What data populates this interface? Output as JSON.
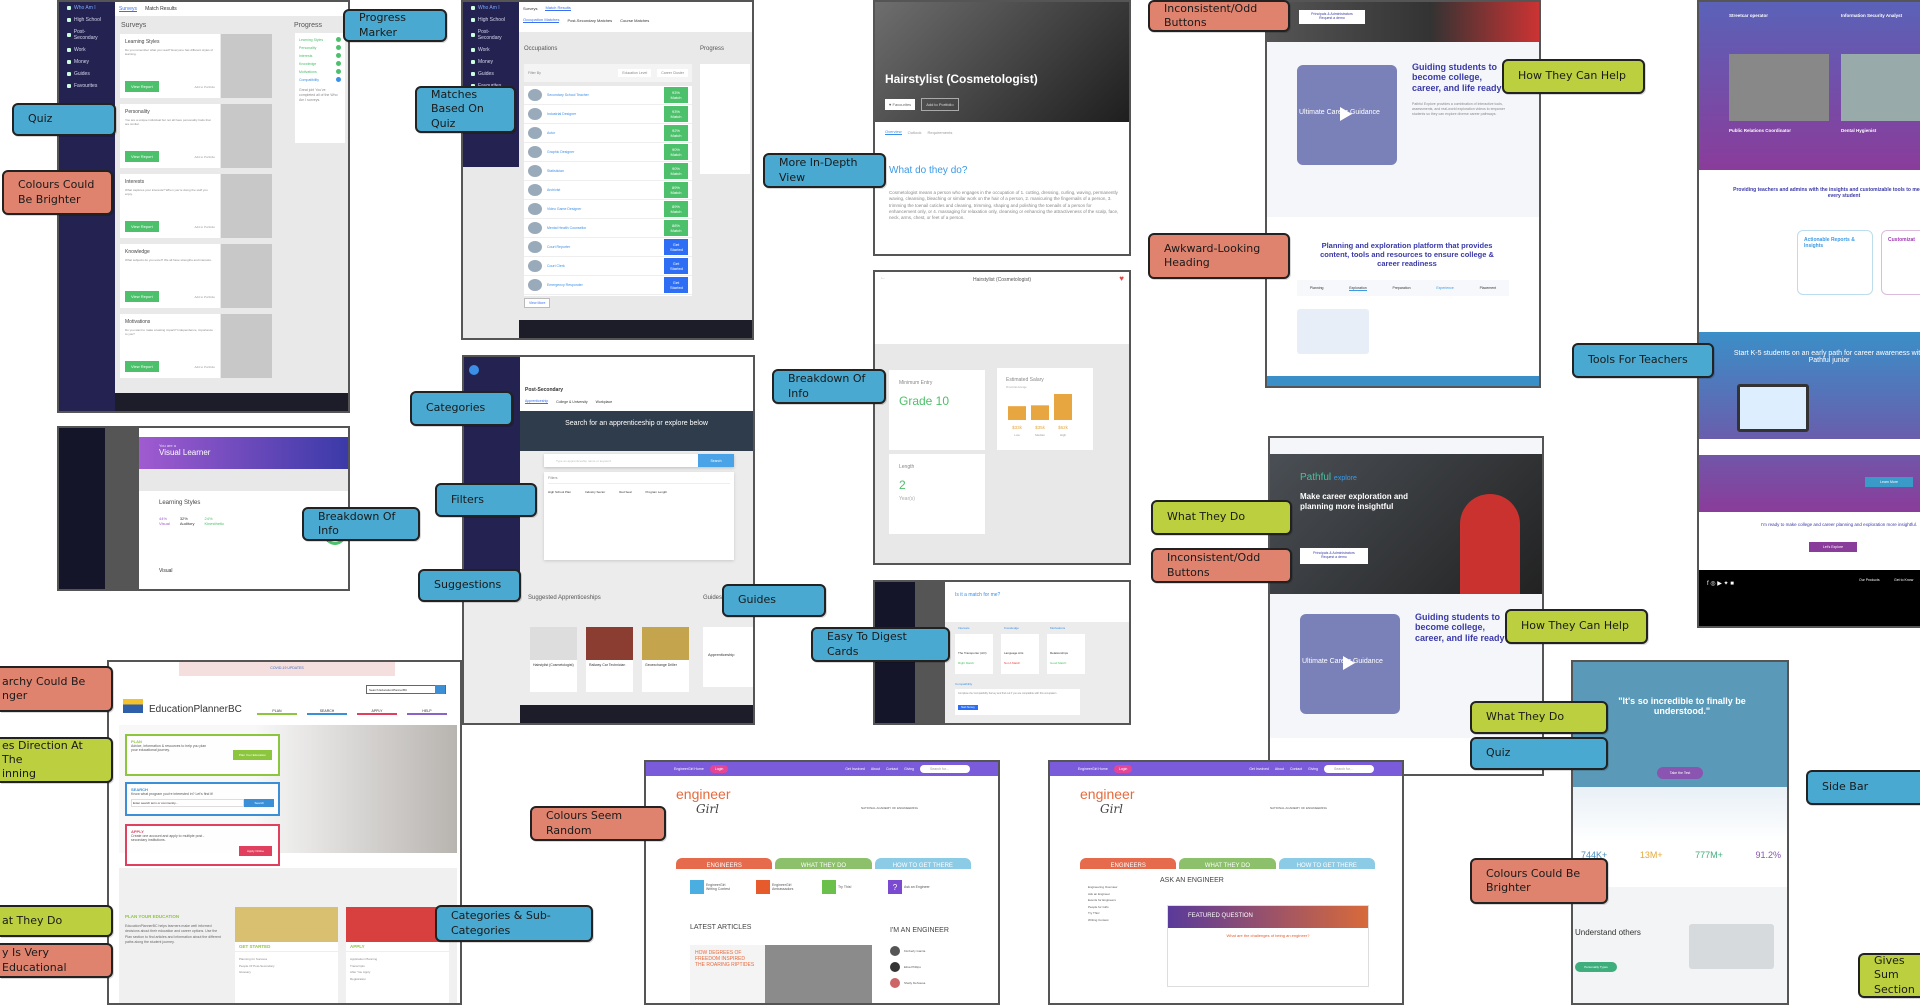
{
  "annotations": {
    "progress_marker": "Progress Marker",
    "quiz_1": "Quiz",
    "colours_brighter_1": "Colours Could Be Brighter",
    "matches_based_on_quiz": "Matches Based On Quiz",
    "more_in_depth_view": "More In-Depth View",
    "inconsistent_buttons_1": "Inconsistent/Odd Buttons",
    "how_they_can_help_1": "How They Can Help",
    "awkward_heading": "Awkward-Looking Heading",
    "tools_for_teachers": "Tools For Teachers",
    "categories": "Categories",
    "breakdown_of_info_1": "Breakdown Of Info",
    "breakdown_of_info_2": "Breakdown Of Info",
    "filters": "Filters",
    "suggestions": "Suggestions",
    "guides": "Guides",
    "easy_to_digest_cards": "Easy To Digest Cards",
    "what_they_do_1": "What They Do",
    "inconsistent_buttons_2": "Inconsistent/Odd Buttons",
    "how_they_can_help_2": "How They Can Help",
    "hierarchy_stronger": "archy Could Be\nnger",
    "gives_direction": "es Direction At The\ninning",
    "colours_seem_random": "Colours Seem Random",
    "what_they_do_2": "What They Do",
    "quiz_2": "Quiz",
    "colours_brighter_2": "Colours Could Be Brighter",
    "side_bar": "Side Bar",
    "what_they_do_3": "at They Do",
    "very_educational": "y Is Very Educational",
    "categories_subcategories": "Categories & Sub-Categories",
    "gives_summary": "Gives Sum\nSection"
  },
  "surveys_screen": {
    "sidebar": [
      "Who Am I",
      "High School",
      "Post-Secondary",
      "Work",
      "Money",
      "Guides",
      "Favourites"
    ],
    "tabs": [
      "Surveys",
      "Match Results"
    ],
    "heading": "Surveys",
    "progress_heading": "Progress",
    "progress_items": [
      "Learning Styles",
      "Personality",
      "Interests",
      "Knowledge",
      "Motivations",
      "Compatibility"
    ],
    "progress_note": "Great job! You've completed all of the Who Am I surveys.",
    "cards": [
      {
        "title": "Learning Styles",
        "button": "View Report",
        "portfolio": "Add to Portfolio"
      },
      {
        "title": "Personality",
        "button": "View Report",
        "portfolio": "Add to Portfolio"
      },
      {
        "title": "Interests",
        "button": "View Report",
        "portfolio": "Add to Portfolio"
      },
      {
        "title": "Knowledge",
        "button": "View Report",
        "portfolio": "Add to Portfolio"
      },
      {
        "title": "Motivations",
        "button": "View Report",
        "portfolio": "Add to Portfolio"
      }
    ]
  },
  "matches_screen": {
    "tabs": [
      "Surveys",
      "Match Results"
    ],
    "subtabs": [
      "Occupation Matches",
      "Post-Secondary Matches",
      "Course Matches"
    ],
    "heading": "Occupations",
    "filter_label": "Filter By",
    "filter_1": "Education Level",
    "filter_2": "Career Cluster",
    "progress_heading": "Progress",
    "rows": [
      {
        "name": "Secondary School Teacher",
        "action": "93% Match"
      },
      {
        "name": "Industrial Designer",
        "action": "93% Match"
      },
      {
        "name": "Actor",
        "action": "92% Match"
      },
      {
        "name": "Graphic Designer",
        "action": "90% Match"
      },
      {
        "name": "Statistician",
        "action": "90% Match"
      },
      {
        "name": "Archivist",
        "action": "89% Match"
      },
      {
        "name": "Video Game Designer",
        "action": "89% Match"
      },
      {
        "name": "Mental Health Counsellor",
        "action": "88% Match"
      },
      {
        "name": "Court Reporter",
        "action": "Get Started"
      },
      {
        "name": "Court Clerk",
        "action": "Get Started"
      },
      {
        "name": "Emergency Responder",
        "action": "Get Started"
      }
    ],
    "view_more": "View More"
  },
  "visual_learner": {
    "subtitle": "You are a",
    "title": "Visual Learner",
    "section": "Learning Styles",
    "stats": [
      {
        "pct": "44%",
        "label": "Visual"
      },
      {
        "pct": "32%",
        "label": "Auditory"
      },
      {
        "pct": "24%",
        "label": "Kinesthetic"
      }
    ],
    "visual_label": "Visual"
  },
  "post_secondary": {
    "heading": "Post-Secondary",
    "tabs": [
      "Apprenticeship",
      "College & University",
      "Workplace"
    ],
    "hero": "Search for an apprenticeship or explore below",
    "search_placeholder": "Type an apprenticeship name or keyword",
    "search_button": "Search",
    "filters_label": "Filters",
    "filter_cols": [
      "High School Plan",
      "Industry Sector",
      "Red Seal",
      "Program Length"
    ],
    "suggested_heading": "Suggested Apprenticeships",
    "suggested": [
      "Hairstylist (Cosmetologist)",
      "Railway Car Technician",
      "Geoexchange Driller"
    ],
    "guides_heading": "Guides",
    "guide_card": "Apprenticeship"
  },
  "hairstylist": {
    "title": "Hairstylist (Cosmetologist)",
    "fav_button": "Favourites",
    "portfolio_button": "Add to Portfolio",
    "tabs": [
      "Overview",
      "Outlook",
      "Requirements"
    ],
    "question": "What do they do?",
    "description": "Cosmetologist means a person who engages in the occupation of 1. cutting, dressing, curling, waving, permanently waving, cleansing, bleaching or similar work on the hair of a person, 2. manicuring the fingernails of a person, 3. trimming the toenail cuticles and cleaning, trimming, shaping and polishing the toenails of a person for enhancement only, or 4. massaging for relaxation only, cleansing or enhancing the attractiveness of the scalp, face, neck, arms, chest, or feet of a person."
  },
  "hairstylist_detail": {
    "header": "Hairstylist (Cosmetologist)",
    "min_entry_label": "Minimum Entry",
    "min_entry_value": "Grade 10",
    "length_label": "Length",
    "length_value": "2",
    "length_unit": "Year(s)",
    "salary_label": "Estimated Salary",
    "salary_sub": "Provincial Average"
  },
  "chart_data": {
    "type": "bar",
    "title": "Estimated Salary",
    "categories": [
      "Low",
      "Median",
      "High"
    ],
    "values": [
      33,
      35,
      62
    ],
    "labels": [
      "$33k",
      "$35k",
      "$62k"
    ],
    "ylabel": "",
    "ylim": [
      0,
      62
    ]
  },
  "match_cards": {
    "heading": "Is it a match for me?",
    "cards": [
      {
        "cat": "Interests",
        "value": "The Transporter (AO)",
        "status": "Right Match",
        "color": "#4cc06a"
      },
      {
        "cat": "Knowledge",
        "value": "Language Arts",
        "status": "Not A Match",
        "color": "#e54545"
      },
      {
        "cat": "Motivations",
        "value": "Relationships",
        "status": "Good Match",
        "color": "#4cc06a"
      }
    ],
    "compat_label": "Compatibility",
    "compat_text": "Complete the Compatibility Survey and find out if you are compatible with this occupation",
    "compat_button": "Start Survey"
  },
  "pathful": {
    "demo_button_1": "Principals & Administrators",
    "demo_button_2": "Request a demo",
    "guiding_heading": "Guiding students to become college, career, and life ready",
    "video_label": "Ultimate Career Guidance",
    "platform_heading": "Planning and exploration platform that provides content, tools and resources to ensure college & career readiness",
    "tabs": [
      "Planning",
      "Exploration",
      "Preparation",
      "Experience",
      "Placement"
    ],
    "logo": "Pathful",
    "logo_sub": "explore",
    "hero_heading": "Make career exploration and planning more insightful"
  },
  "pathful_right": {
    "videos": [
      "Streetcar operator",
      "Information Security Analyst",
      "Public Relations Coordinator",
      "Dental Hygienist"
    ],
    "teachers_heading": "Providing teachers and admins with the insights and customizable tools to meet the needs of every student",
    "card1": "Actionable Reports & Insights",
    "card2": "Customizat",
    "k5_heading": "Start K-5 students on an early path for career awareness with Pathful junior",
    "learn_more": "Learn More",
    "ready_text": "I'm ready to make college and career planning and exploration more insightful.",
    "lets_explore": "Let's Explore",
    "footer_cols": [
      "Our Products",
      "Get to Know"
    ]
  },
  "edplanner": {
    "covid": "COVID-19 UPDATES",
    "search_placeholder": "Search EducationPlannerBC",
    "radio_1": "Site",
    "radio_2": "Programs",
    "logo": "EducationPlannerBC",
    "nav": [
      {
        "label": "PLAN",
        "color": "#8cc63f"
      },
      {
        "label": "SEARCH",
        "color": "#3a8fd6"
      },
      {
        "label": "APPLY",
        "color": "#e0405e"
      },
      {
        "label": "HELP",
        "color": "#8a63c9"
      }
    ],
    "plan_title": "PLAN",
    "plan_text": "Advice, information & resources to help you plan your educational journey.",
    "plan_button": "Plan Your Education",
    "search_title": "SEARCH",
    "search_text": "Know what program you're interested in? Let's find it!",
    "search_input": "Enter search term or community...",
    "search_button": "Search",
    "apply_title": "APPLY",
    "apply_text": "Create one account and apply to multiple post - secondary institutions.",
    "apply_button": "Apply Online",
    "plan_your_ed": "PLAN YOUR EDUCATION",
    "plan_your_ed_text": "EducationPlannerBC helps learners make well informed decisions about their education and career options. Use the Plan section to find articles and information about the different paths along the student journey.",
    "get_started": "GET STARTED",
    "get_started_links": [
      "Planning for Success",
      "People Of Post-Secondary",
      "Glossary"
    ],
    "apply_heading": "APPLY",
    "apply_links": [
      "Application Planning",
      "Transcripts",
      "After You Apply",
      "Registration"
    ]
  },
  "engineergirl": {
    "topnav_home": "EngineerGirl Home",
    "login": "Login",
    "links": [
      "Get Involved",
      "About",
      "Contact",
      "Giving"
    ],
    "search": "Search for...",
    "logo_1": "engineer",
    "logo_2": "Girl",
    "nae": "NATIONAL ACADEMY OF ENGINEERING",
    "tabs": [
      "ENGINEERS",
      "WHAT THEY DO",
      "HOW TO GET THERE"
    ],
    "icons": [
      "EngineerGirl Writing Contest",
      "EngineerGirl Ambassadors",
      "Try This!",
      "Ask an Engineer"
    ],
    "latest": "LATEST ARTICLES",
    "article": "HOW DEGREES OF FREEDOM INSPIRED THE ROARING RIPTIDES",
    "im_engineer": "I'M AN ENGINEER",
    "people": [
      "Kimberly Garcia",
      "Elisa Phillips",
      "Shelly DeSousa"
    ],
    "ask_heading": "ASK AN ENGINEER",
    "featured": "FEATURED QUESTION",
    "question": "What are the challenges of being an engineer?",
    "side_links": [
      "Engineering Overview",
      "Ask an Engineer",
      "Events for Engineers",
      "People for Girls",
      "Try This!",
      "Writing Contest"
    ]
  },
  "personalities": {
    "quote": "\"It's so incredible to finally be understood.\"",
    "button": "Take the Test",
    "stats": [
      {
        "value": "744K+",
        "color": "#4a8fc0"
      },
      {
        "value": "13M+",
        "color": "#e6a93b"
      },
      {
        "value": "777M+",
        "color": "#3fae7d"
      },
      {
        "value": "91.2%",
        "color": "#8a55b0"
      }
    ],
    "understand": "Understand others",
    "understand_button": "Personality Types"
  }
}
